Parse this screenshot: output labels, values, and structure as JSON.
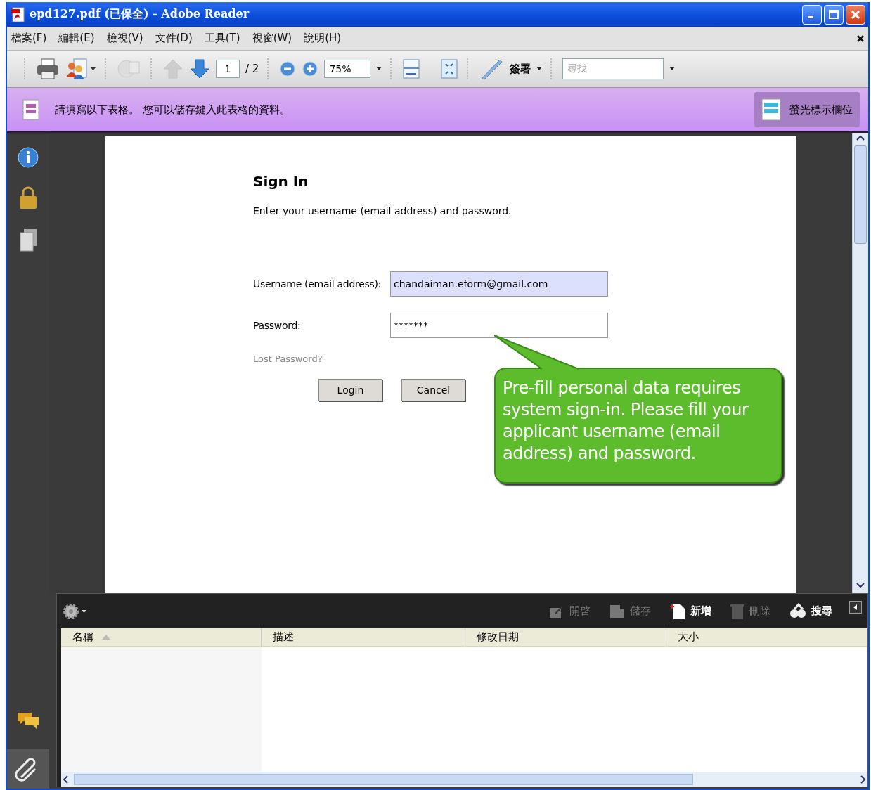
{
  "window": {
    "title": "epd127.pdf (已保全) - Adobe Reader"
  },
  "menu": [
    {
      "label": "檔案(F)"
    },
    {
      "label": "編輯(E)"
    },
    {
      "label": "檢視(V)"
    },
    {
      "label": "文件(D)"
    },
    {
      "label": "工具(T)"
    },
    {
      "label": "視窗(W)"
    },
    {
      "label": "說明(H)"
    }
  ],
  "toolbar": {
    "nav": [
      {
        "kind": "prev",
        "disabled": true
      },
      {
        "kind": "next",
        "disabled": false
      }
    ],
    "page_field": {
      "value": "1"
    },
    "page_total": "/ 2",
    "zoom_field": {
      "value": "75%"
    },
    "sign_button": {
      "label": "簽署"
    },
    "search_field": {
      "placeholder": "尋找"
    }
  },
  "form_bar": {
    "message": "請填寫以下表格。 您可以儲存鍵入此表格的資料。",
    "highlight_button": {
      "label": "螢光標示欄位"
    }
  },
  "document": {
    "heading": "Sign In",
    "instructions": "Enter your username (email address) and password.",
    "fields": [
      {
        "label": "Username (email address):",
        "value": "chandaiman.eform@gmail.com",
        "highlighted": true
      },
      {
        "label": "Password:",
        "value": "*******",
        "highlighted": false
      }
    ],
    "link": "Lost Password?",
    "buttons": [
      "Login",
      "Cancel"
    ],
    "callout": "Pre-fill personal data requires system sign-in. Please fill your applicant username (email address) and password."
  },
  "attachments": {
    "tools": [
      {
        "label": "開啓",
        "disabled": true
      },
      {
        "label": "儲存",
        "disabled": true
      },
      {
        "label": "新增",
        "disabled": false
      },
      {
        "label": "刪除",
        "disabled": true
      },
      {
        "label": "搜尋",
        "disabled": false
      }
    ],
    "columns": [
      {
        "label": "名稱",
        "sorted": true
      },
      {
        "label": "描述",
        "sorted": false
      },
      {
        "label": "修改日期",
        "sorted": false
      },
      {
        "label": "大小",
        "sorted": false
      }
    ]
  }
}
